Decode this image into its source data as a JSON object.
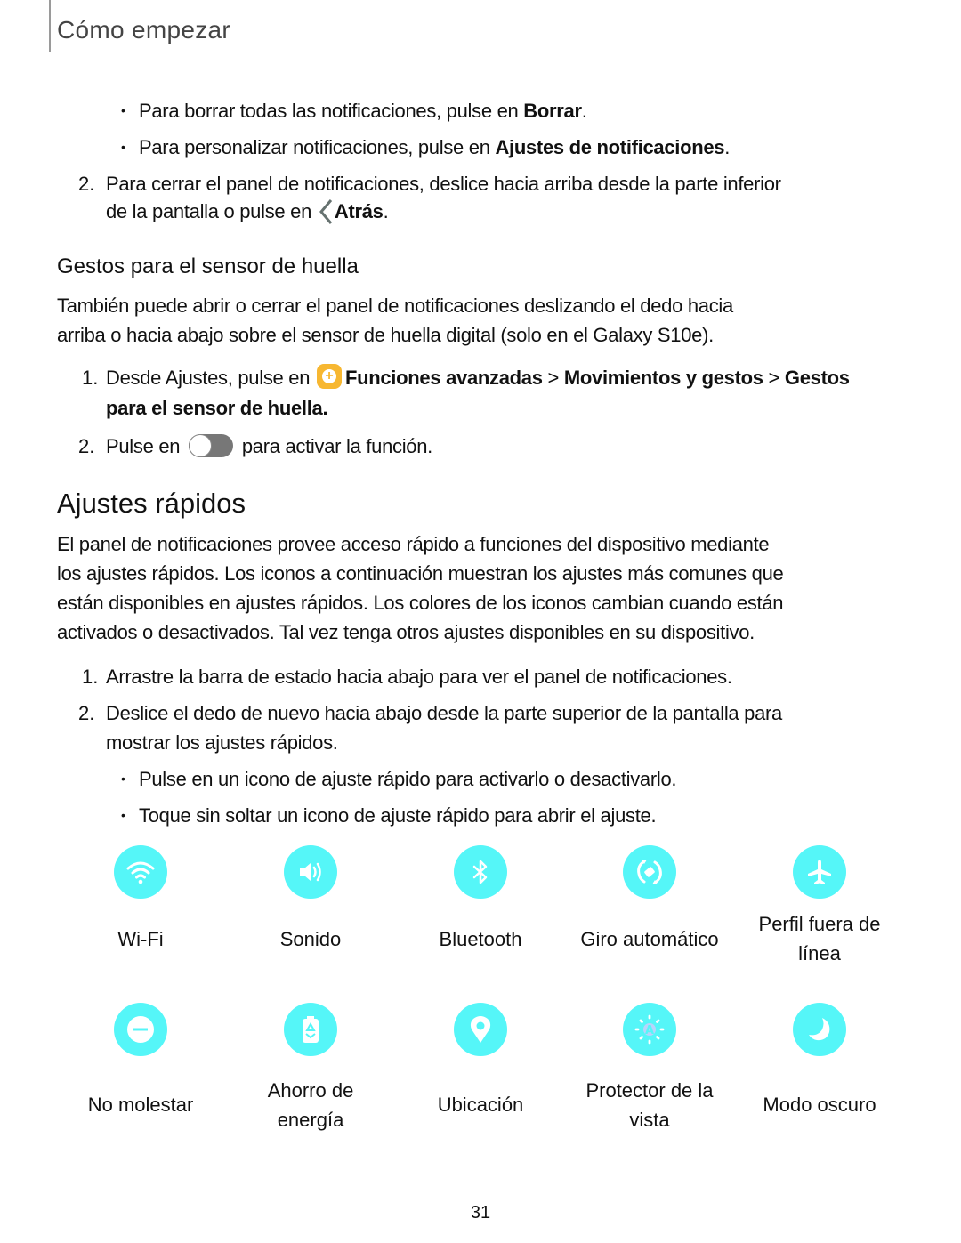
{
  "header": {
    "chapter_title": "Cómo empezar"
  },
  "notifications_steps": {
    "bullet_1": {
      "text": "Para borrar todas las notificaciones, pulse en ",
      "bold": "Borrar",
      "end": "."
    },
    "bullet_2": {
      "text": "Para personalizar notificaciones, pulse en ",
      "bold": "Ajustes de notificaciones",
      "end": "."
    },
    "step_2": {
      "number": "2.",
      "line1": "Para cerrar el panel de notificaciones, deslice hacia arriba desde la parte inferior",
      "line2": "de la pantalla o pulse en ",
      "bold": "Atrás",
      "end": "."
    }
  },
  "fingerprint_section": {
    "heading": "Gestos para el sensor de huella",
    "intro_line1": "También puede abrir o cerrar el panel de notificaciones deslizando el dedo hacia",
    "intro_line2": "arriba o hacia abajo sobre el sensor de huella digital (solo en el Galaxy S10e).",
    "step_1": {
      "number": "1.",
      "text": "Desde Ajustes, pulse en ",
      "bold1": "Funciones avanzadas",
      "sep1": " > ",
      "bold2": "Movimientos y gestos",
      "sep2": " > ",
      "bold3": "Gestos",
      "bold4": "para el sensor de huella",
      "end": "."
    },
    "step_2": {
      "number": "2.",
      "text_before": "Pulse en ",
      "text_after": " para activar la función."
    }
  },
  "quick_settings_section": {
    "heading": "Ajustes rápidos",
    "intro": [
      "El panel de notificaciones provee acceso rápido a funciones del dispositivo mediante",
      "los ajustes rápidos. Los iconos a continuación muestran los ajustes más comunes que",
      "están disponibles en ajustes rápidos. Los colores de los iconos cambian cuando están",
      "activados o desactivados. Tal vez tenga otros ajustes disponibles en su dispositivo."
    ],
    "step_1": {
      "number": "1.",
      "text": "Arrastre la barra de estado hacia abajo para ver el panel de notificaciones."
    },
    "step_2": {
      "number": "2.",
      "line1": "Deslice el dedo de nuevo hacia abajo desde la parte superior de la pantalla para",
      "line2": "mostrar los ajustes rápidos."
    },
    "bullet_1": "Pulse en un icono de ajuste rápido para activarlo o desactivarlo.",
    "bullet_2": "Toque sin soltar un icono de ajuste rápido para abrir el ajuste.",
    "icon_color": "#55f6f8",
    "tiles_row1": [
      {
        "icon": "wifi-icon",
        "label_1": "Wi-Fi",
        "label_2": ""
      },
      {
        "icon": "sound-icon",
        "label_1": "Sonido",
        "label_2": ""
      },
      {
        "icon": "bluetooth-icon",
        "label_1": "Bluetooth",
        "label_2": ""
      },
      {
        "icon": "auto-rotate-icon",
        "label_1": "Giro automático",
        "label_2": ""
      },
      {
        "icon": "airplane-icon",
        "label_1": "Perfil fuera de",
        "label_2": "línea"
      }
    ],
    "tiles_row2": [
      {
        "icon": "do-not-disturb-icon",
        "label_1": "No molestar",
        "label_2": ""
      },
      {
        "icon": "power-saving-icon",
        "label_1": "Ahorro de",
        "label_2": "energía"
      },
      {
        "icon": "location-icon",
        "label_1": "Ubicación",
        "label_2": ""
      },
      {
        "icon": "eye-comfort-icon",
        "label_1": "Protector de la",
        "label_2": "vista"
      },
      {
        "icon": "dark-mode-icon",
        "label_1": "Modo oscuro",
        "label_2": ""
      }
    ]
  },
  "footer": {
    "page_number": "31"
  }
}
